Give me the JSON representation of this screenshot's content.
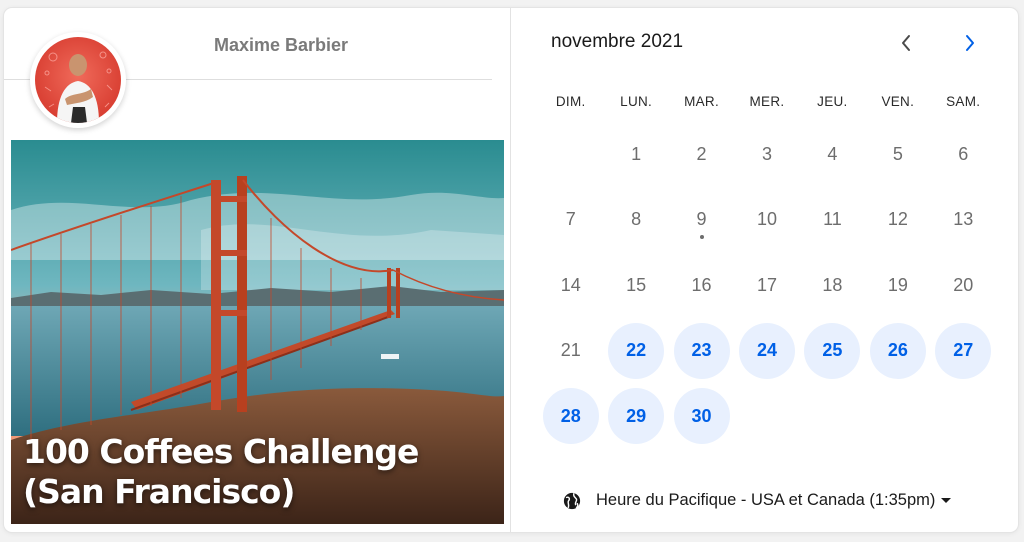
{
  "host": {
    "name": "Maxime Barbier"
  },
  "event": {
    "title_line1": "100 Coffees Challenge",
    "title_line2": "(San Francisco)"
  },
  "calendar": {
    "month_label": "novembre 2021",
    "weekdays": [
      "DIM.",
      "LUN.",
      "MAR.",
      "MER.",
      "JEU.",
      "VEN.",
      "SAM."
    ],
    "first_weekday_index": 1,
    "days_in_month": 30,
    "available_days": [
      22,
      23,
      24,
      25,
      26,
      27,
      28,
      29,
      30
    ],
    "today": 9
  },
  "timezone": {
    "label": "Heure du Pacifique - USA et Canada (1:35pm)"
  },
  "colors": {
    "accent": "#0060e6",
    "available_bg": "#e8f0fe",
    "muted_day": "#6d6d6d"
  },
  "icons": {
    "prev": "chevron-left-icon",
    "next": "chevron-right-icon",
    "timezone": "globe-icon",
    "dropdown": "caret-down-icon"
  }
}
